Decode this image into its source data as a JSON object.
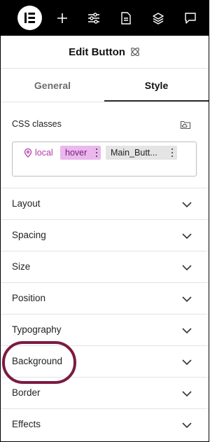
{
  "topbar": {
    "logo_icon": "elementor-logo-icon",
    "icons": [
      "plus-icon",
      "sliders-icon",
      "document-icon",
      "layers-icon",
      "chat-icon"
    ]
  },
  "header": {
    "title": "Edit Button",
    "icon": "atom-icon"
  },
  "tabs": [
    {
      "label": "General",
      "active": false
    },
    {
      "label": "Style",
      "active": true
    }
  ],
  "css_classes": {
    "label": "CSS classes",
    "icon": "folder-cloud-icon",
    "chips": [
      {
        "label": "local",
        "icon": "location-pin-icon",
        "color": "#b23aa8"
      },
      {
        "label": "hover",
        "background": "#eab8ec",
        "color": "#7e1b80"
      },
      {
        "label": "Main_Butt...",
        "background": "#e4e4e4"
      }
    ]
  },
  "sections": [
    {
      "label": "Layout"
    },
    {
      "label": "Spacing"
    },
    {
      "label": "Size"
    },
    {
      "label": "Position"
    },
    {
      "label": "Typography"
    },
    {
      "label": "Background"
    },
    {
      "label": "Border"
    },
    {
      "label": "Effects"
    }
  ],
  "highlight": {
    "target": "Background",
    "color": "#7c1b42"
  }
}
